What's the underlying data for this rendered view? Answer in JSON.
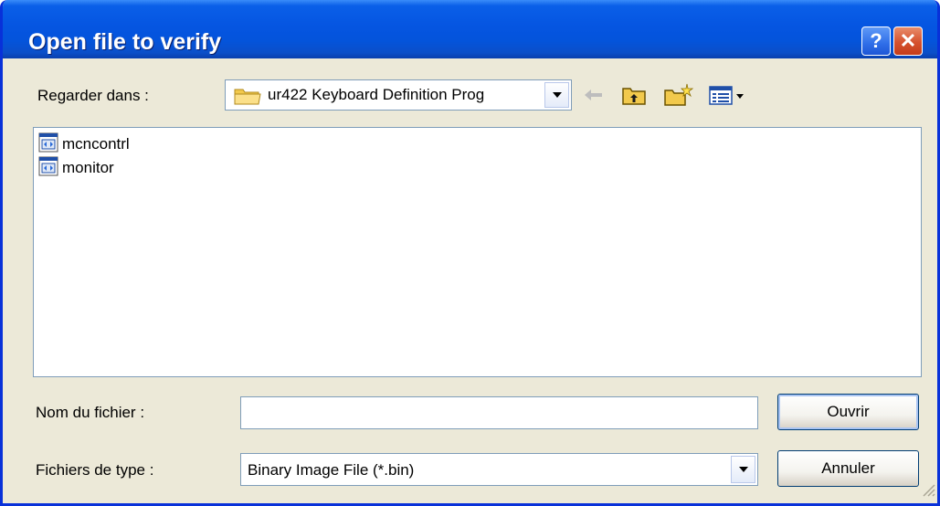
{
  "window": {
    "title": "Open file to verify",
    "help_label": "?",
    "close_label": "✕"
  },
  "lookin": {
    "label": "Regarder dans :",
    "value": "ur422 Keyboard Definition Prog"
  },
  "files": [
    {
      "name": "mcncontrl",
      "icon": "program-file-icon"
    },
    {
      "name": "monitor",
      "icon": "program-file-icon"
    }
  ],
  "filename": {
    "label": "Nom du fichier :",
    "value": ""
  },
  "filetype": {
    "label": "Fichiers de type :",
    "value": "Binary Image File (*.bin)"
  },
  "buttons": {
    "open": "Ouvrir",
    "cancel": "Annuler"
  },
  "colors": {
    "title_bar": "#0555e1",
    "dialog_bg": "#ece9d8",
    "close_button": "#d5512e",
    "folder": "#f2c94c"
  }
}
